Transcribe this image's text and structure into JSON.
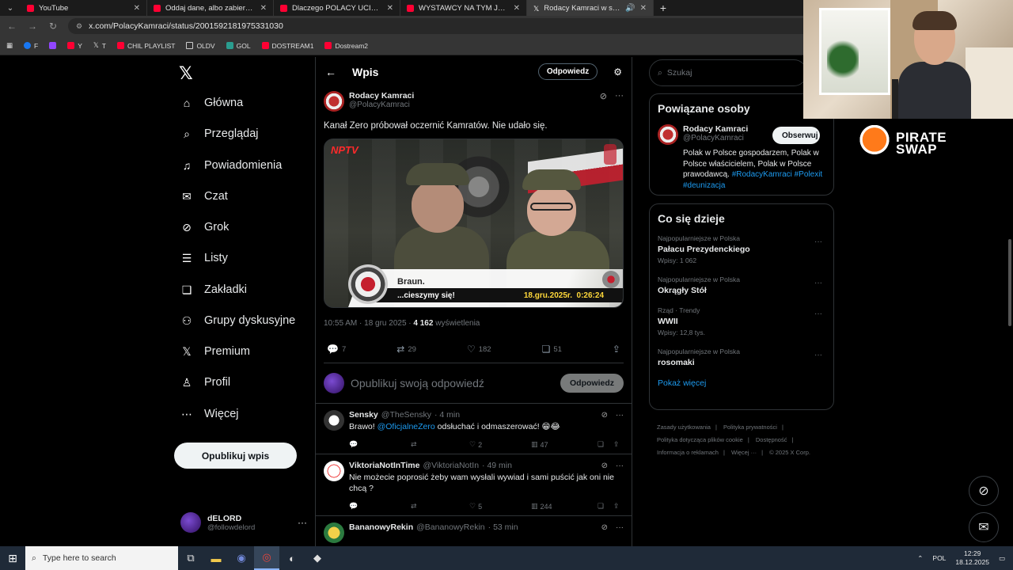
{
  "browser": {
    "tabs": [
      {
        "title": "YouTube",
        "active": false,
        "favicon": "youtube"
      },
      {
        "title": "Oddaj dane, albo zabierzemy ci",
        "active": false,
        "favicon": "youtube"
      },
      {
        "title": "Dlaczego POLACY UCIEKAJĄ z",
        "active": false,
        "favicon": "youtube"
      },
      {
        "title": "WYSTAWCY NA TYM JARMARKU",
        "active": false,
        "favicon": "youtube"
      },
      {
        "title": "Rodacy Kamraci w serwisie",
        "active": true,
        "favicon": "x"
      }
    ],
    "url": "x.com/PolacyKamraci/status/2001592181975331030",
    "bookmarks": [
      "F",
      "",
      "Y",
      "T",
      "CHIL PLAYLIST",
      "OLDV",
      "GOL",
      "DOSTREAM1",
      "Dostream2"
    ]
  },
  "leftnav": {
    "items": [
      {
        "label": "Główna",
        "icon": "home-icon"
      },
      {
        "label": "Przeglądaj",
        "icon": "search-icon"
      },
      {
        "label": "Powiadomienia",
        "icon": "bell-icon"
      },
      {
        "label": "Czat",
        "icon": "mail-icon"
      },
      {
        "label": "Grok",
        "icon": "grok-icon"
      },
      {
        "label": "Listy",
        "icon": "list-icon"
      },
      {
        "label": "Zakładki",
        "icon": "bookmark-icon"
      },
      {
        "label": "Grupy dyskusyjne",
        "icon": "community-icon"
      },
      {
        "label": "Premium",
        "icon": "x-icon"
      },
      {
        "label": "Profil",
        "icon": "profile-icon"
      },
      {
        "label": "Więcej",
        "icon": "more-icon"
      }
    ],
    "post_button": "Opublikuj wpis",
    "me": {
      "name": "dELORD",
      "handle": "@followdelord"
    }
  },
  "main": {
    "header_title": "Wpis",
    "reply_pill": "Odpowiedz",
    "tweet": {
      "author_name": "Rodacy Kamraci",
      "author_handle": "@PolacyKamraci",
      "text": "Kanał Zero próbował oczernić Kamratów. Nie udało się.",
      "media": {
        "logo": "NPTV",
        "lower_name": "Braun.",
        "lower_sub": "...cieszymy się!",
        "date": "18.gru.2025r.",
        "time": "0:26:24"
      },
      "meta_time": "10:55 AM · 18 gru 2025 · ",
      "views": "4 162",
      "views_label": " wyświetlenia",
      "replies": "7",
      "reposts": "29",
      "likes": "182",
      "bookmarks": "51"
    },
    "composer": {
      "placeholder": "Opublikuj swoją odpowiedź",
      "button": "Odpowiedz"
    },
    "replies": [
      {
        "name": "Sensky",
        "handle": "@TheSensky",
        "time": "· 4 min",
        "text_pre": "Brawo! ",
        "link": "@OficjalneZero",
        "text_post": " odsłuchać i odmaszerować! 😁😂",
        "replies": "",
        "reposts": "",
        "likes": "2",
        "views": "47"
      },
      {
        "name": "ViktoriaNotInTime",
        "handle": "@ViktoriaNotIn",
        "time": "· 49 min",
        "text_pre": "Nie możecie poprosić żeby wam wysłali wywiad i sami puścić jak oni nie chcą ?",
        "link": "",
        "text_post": "",
        "replies": "",
        "reposts": "",
        "likes": "5",
        "views": "244"
      },
      {
        "name": "BananowyRekin",
        "handle": "@BananowyRekin",
        "time": "· 53 min",
        "text_pre": "",
        "link": "",
        "text_post": "",
        "replies": "",
        "reposts": "",
        "likes": "",
        "views": ""
      }
    ]
  },
  "right": {
    "search_placeholder": "Szukaj",
    "people_title": "Powiązane osoby",
    "person": {
      "name": "Rodacy Kamraci",
      "handle": "@PolacyKamraci",
      "follow": "Obserwuj",
      "bio": "Polak w Polsce gospodarzem, Polak w Polsce właścicielem, Polak w Polsce prawodawcą. ",
      "tags": "#RodacyKamraci #Polexit #deunizacja"
    },
    "trends_title": "Co się dzieje",
    "trends": [
      {
        "category": "Najpopularniejsze w Polska",
        "title": "Pałacu Prezydenckiego",
        "count": "Wpisy: 1 062"
      },
      {
        "category": "Najpopularniejsze w Polska",
        "title": "Okrągły Stół",
        "count": ""
      },
      {
        "category": "Rząd · Trendy",
        "title": "WWII",
        "count": "Wpisy: 12,8 tys."
      },
      {
        "category": "Najpopularniejsze w Polska",
        "title": "rosomaki",
        "count": ""
      }
    ],
    "show_more": "Pokaż więcej",
    "footer": [
      "Zasady użytkowania",
      "Polityka prywatności",
      "Polityka dotycząca plików cookie",
      "Dostępność",
      "Informacja o reklamach",
      "Więcej ···",
      "© 2025 X Corp."
    ]
  },
  "overlay": {
    "sponsor": "PIRATE SWAP"
  },
  "taskbar": {
    "search_placeholder": "Type here to search",
    "lang": "POL",
    "time": "12:29",
    "date": "18.12.2025"
  }
}
